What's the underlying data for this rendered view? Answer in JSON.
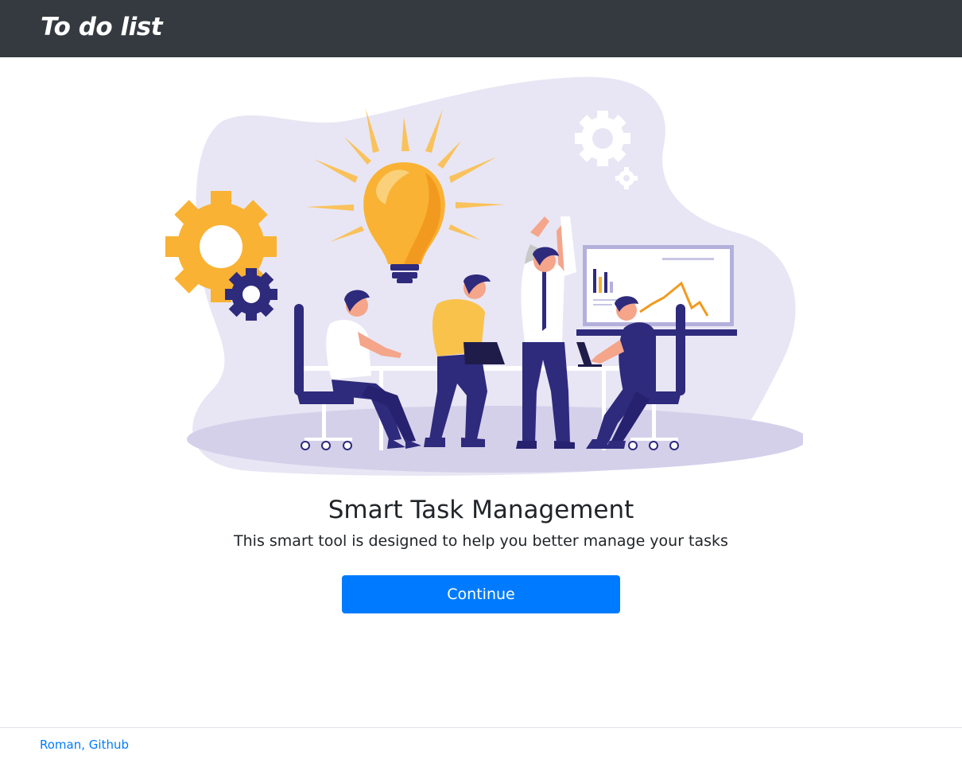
{
  "header": {
    "brand": "To do list"
  },
  "hero": {
    "illustration_icon": "team-brainstorm-illustration",
    "title": "Smart Task Management",
    "subtitle": "This smart tool is designed to help you better manage your tasks",
    "continue_label": "Continue"
  },
  "footer": {
    "credit": "Roman, Github"
  },
  "colors": {
    "navbar": "#343a40",
    "primary": "#007bff",
    "text": "#212529",
    "illustration_bg": "#e8e6f4",
    "accent_yellow": "#f9b233",
    "accent_navy": "#2e2a7c"
  }
}
